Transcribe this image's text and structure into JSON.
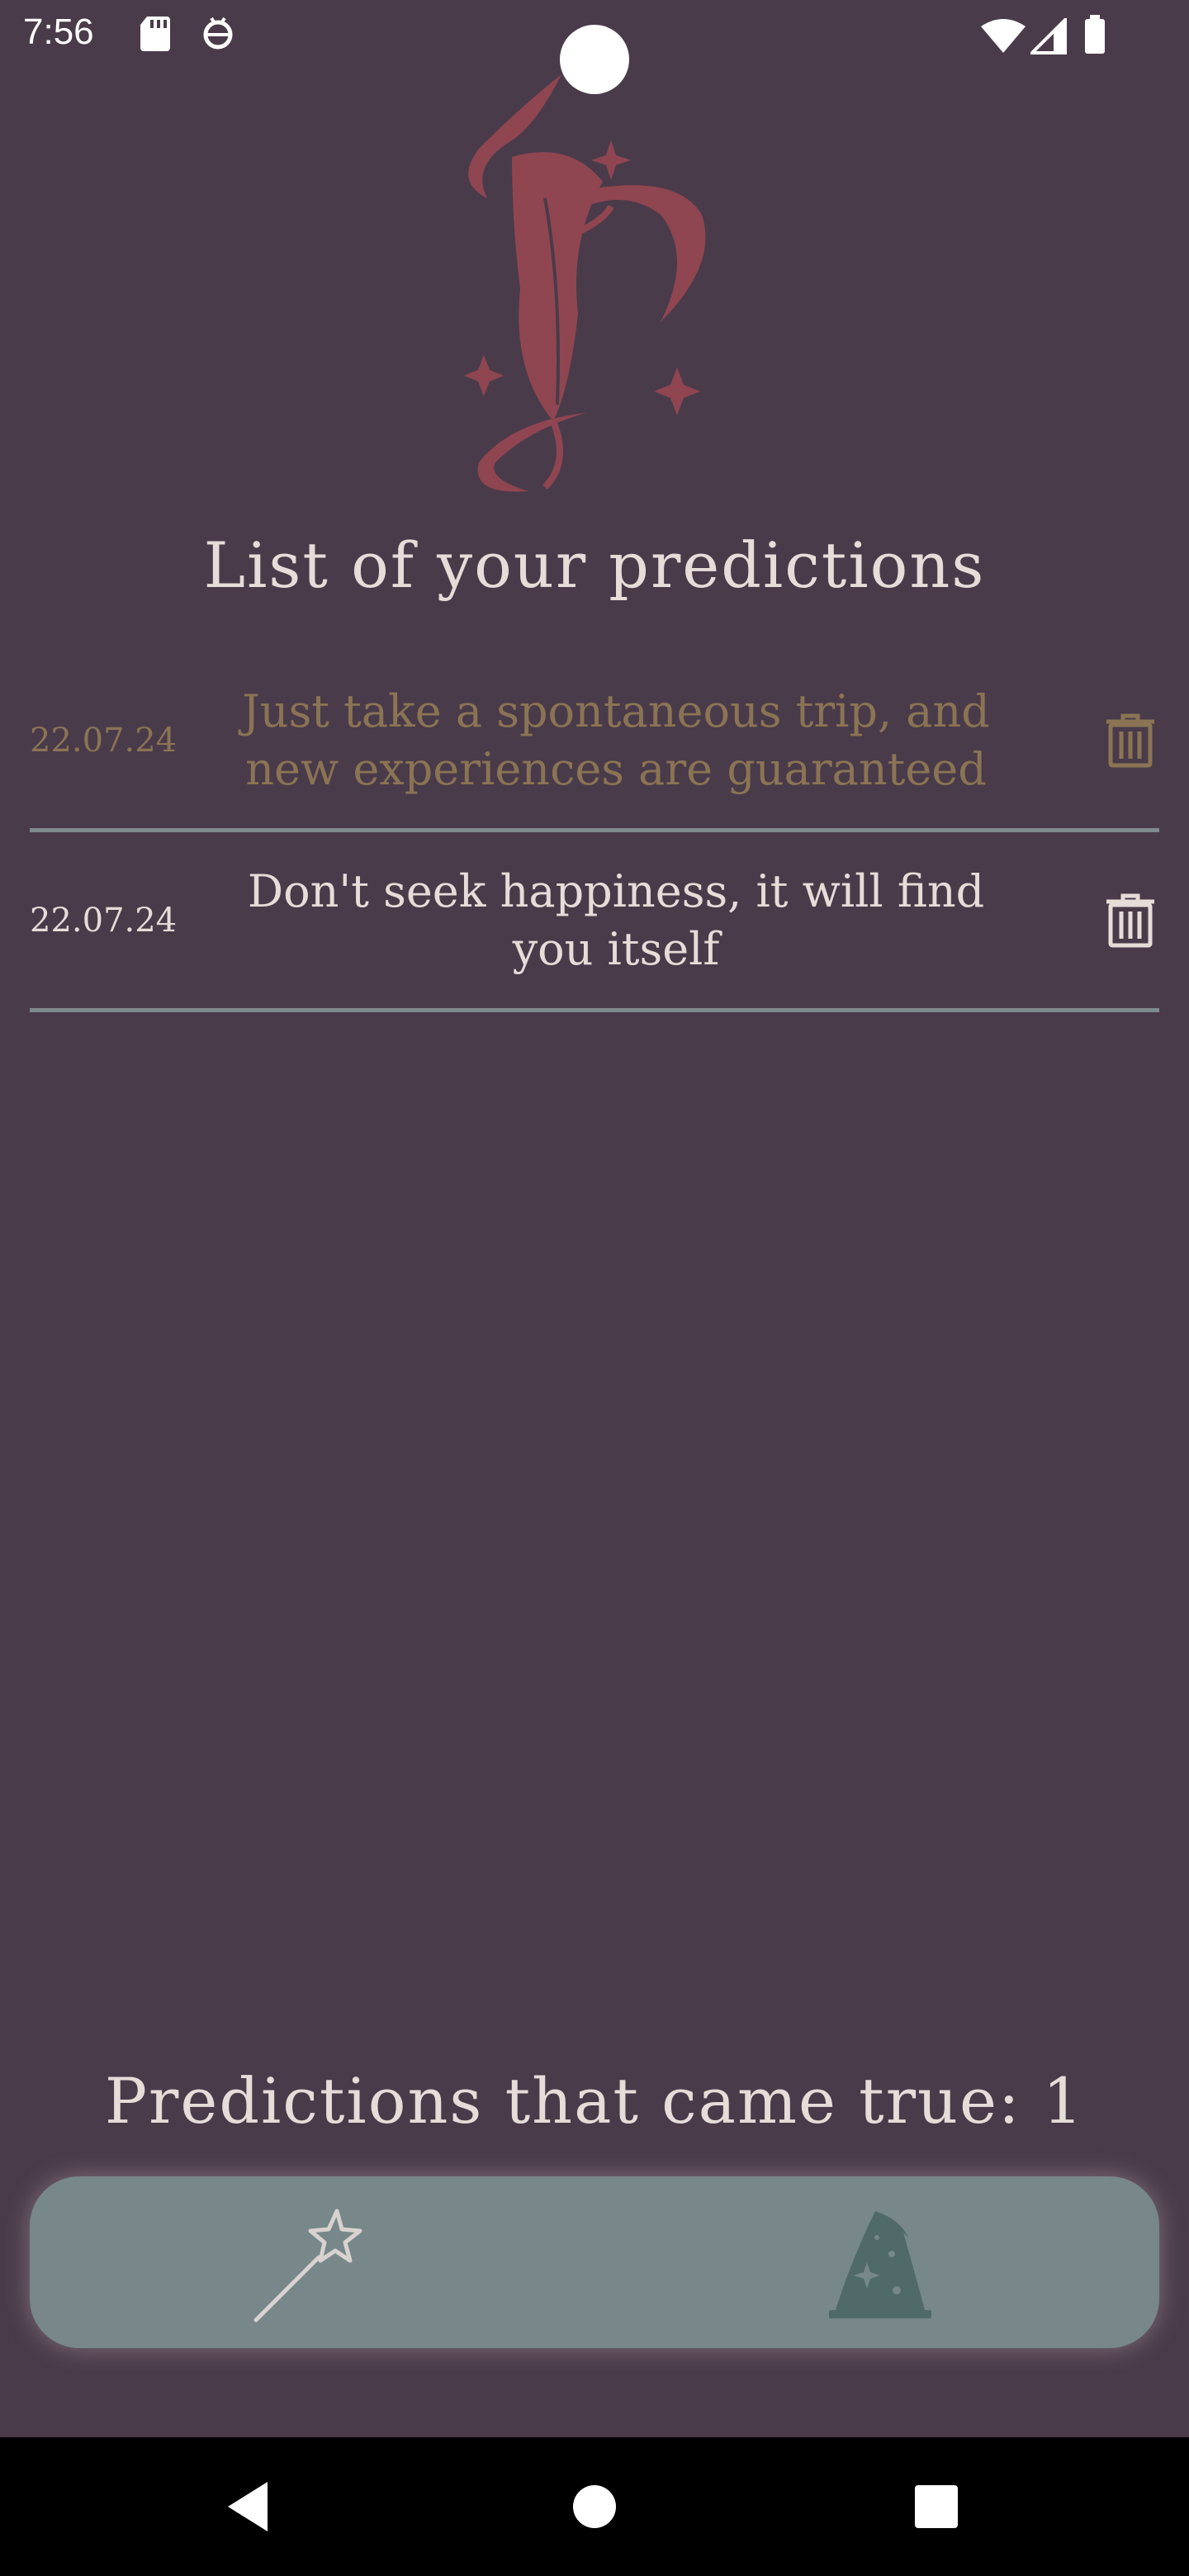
{
  "status_bar": {
    "time": "7:56",
    "icons": [
      "sd-card-icon",
      "android-debug-icon",
      "wifi-icon",
      "signal-icon",
      "battery-icon"
    ]
  },
  "header": {
    "logo_icon": "quill-feather-logo-icon",
    "title": "List of your predictions"
  },
  "predictions": [
    {
      "date": "22.07.24",
      "text": "Just take a spontaneous trip, and new experiences are guaranteed",
      "state": "came-true",
      "delete_icon": "trash-icon"
    },
    {
      "date": "22.07.24",
      "text": "Don't seek happiness, it will find you itself",
      "state": "pending",
      "delete_icon": "trash-icon"
    }
  ],
  "counter": {
    "text": "Predictions that came true: 1"
  },
  "bottom_nav": {
    "items": [
      {
        "icon": "magic-wand-icon",
        "selected": false
      },
      {
        "icon": "wizard-hat-icon",
        "selected": true
      }
    ]
  },
  "colors": {
    "background": "#4a3b4a",
    "logo": "#8f4651",
    "text_primary": "#e6dcd8",
    "text_done": "#8a7454",
    "divider": "#7d8a8e",
    "nav_bar": "#77878a",
    "nav_selected": "#4f6a68"
  },
  "android_nav": {
    "back": "back-icon",
    "home": "home-icon",
    "recents": "recents-icon"
  }
}
